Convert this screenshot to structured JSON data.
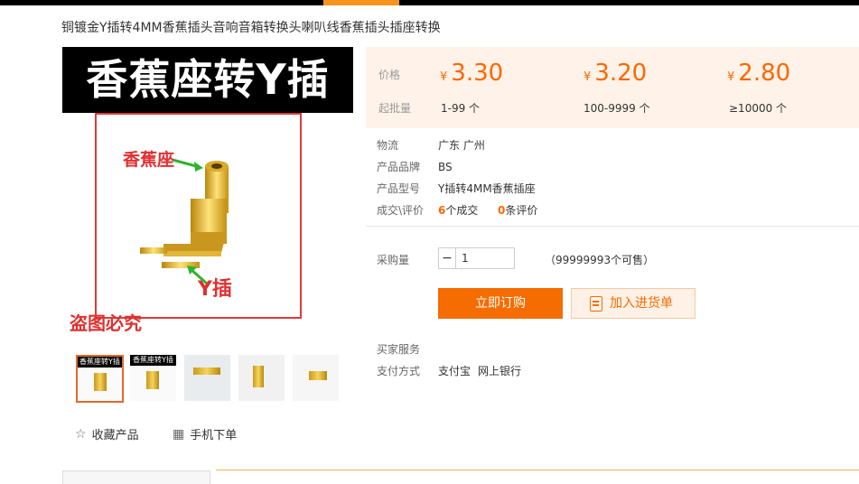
{
  "title": "铜镀金Y插转4MM香蕉插头音响音箱转换头喇叭线香蕉插头插座转换",
  "main_image": {
    "banner": "香蕉座转Y插",
    "label_socket": "香蕉座",
    "label_y": "Y插",
    "watermark": "盗图必究"
  },
  "thumbnails": [
    {
      "caption": "香蕉座转Y插"
    },
    {
      "caption": "香蕉座转Y插"
    },
    {
      "caption": ""
    },
    {
      "caption": ""
    },
    {
      "caption": ""
    }
  ],
  "actions": {
    "favorite": "收藏产品",
    "mobile_order": "手机下单"
  },
  "pricing": {
    "price_label": "价格",
    "moq_label": "起批量",
    "currency": "¥",
    "tiers": [
      {
        "price": "3.30",
        "range": "1-99 个"
      },
      {
        "price": "3.20",
        "range": "100-9999 个"
      },
      {
        "price": "2.80",
        "range": "≥10000 个"
      }
    ]
  },
  "info": {
    "logistics_label": "物流",
    "logistics_value": "广东 广州",
    "brand_label": "产品品牌",
    "brand_value": "BS",
    "model_label": "产品型号",
    "model_value": "Y插转4MM香蕉插座",
    "deals_label": "成交\\评价",
    "deals_count": "6",
    "deals_suffix": "个成交",
    "reviews_count": "0",
    "reviews_suffix": "条评价"
  },
  "purchase": {
    "qty_label": "采购量",
    "qty_value": "1",
    "stock_text": "（99999993个可售）",
    "buy_now": "立即订购",
    "add_to_cart": "加入进货单"
  },
  "services": {
    "buyer_service_label": "买家服务",
    "payment_label": "支付方式",
    "payment_methods": [
      "支付宝",
      "网上银行"
    ]
  },
  "colors": {
    "accent": "#f56c00",
    "price": "#ff6600",
    "price_bg": "#fff2e8"
  }
}
